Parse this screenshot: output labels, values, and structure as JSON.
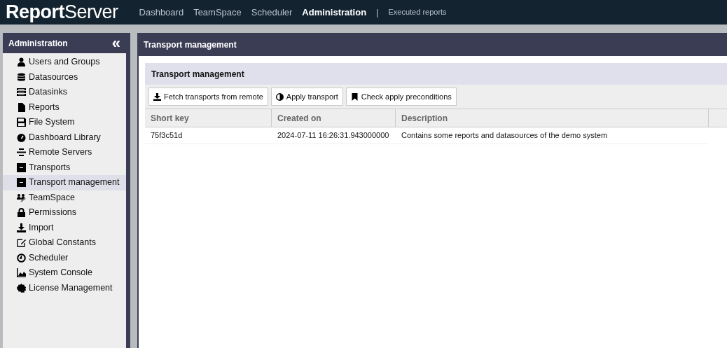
{
  "logo": "**Report**Server",
  "top_nav": [
    {
      "label": "Dashboard",
      "selected": false
    },
    {
      "label": "TeamSpace",
      "selected": false
    },
    {
      "label": "Scheduler",
      "selected": false
    },
    {
      "label": "Administration",
      "selected": true
    }
  ],
  "top_separator": "|",
  "top_link": "Executed reports",
  "sidebar": {
    "title": "Administration",
    "collapse": "«",
    "items": [
      {
        "label": "Users and Groups",
        "selected": false
      },
      {
        "label": "Datasources",
        "selected": false
      },
      {
        "label": "Datasinks",
        "selected": false
      },
      {
        "label": "Reports",
        "selected": false
      },
      {
        "label": "File System",
        "selected": false
      },
      {
        "label": "Dashboard Library",
        "selected": false
      },
      {
        "label": "Remote Servers",
        "selected": false
      },
      {
        "label": "Transports",
        "selected": false
      },
      {
        "label": "Transport management",
        "selected": true
      },
      {
        "label": "TeamSpace",
        "selected": false
      },
      {
        "label": "Permissions",
        "selected": false
      },
      {
        "label": "Import",
        "selected": false
      },
      {
        "label": "Global Constants",
        "selected": false
      },
      {
        "label": "Scheduler",
        "selected": false
      },
      {
        "label": "System Console",
        "selected": false
      },
      {
        "label": "License Management",
        "selected": false
      }
    ]
  },
  "main": {
    "title": "Transport management",
    "panel_title": "Transport management",
    "toolbar": [
      "Fetch transports from remote",
      "Apply transport",
      "Check apply preconditions"
    ],
    "table": {
      "columns": [
        "Short key",
        "Created on",
        "Description"
      ],
      "rows": [
        [
          "75f3c51d",
          "2024-07-11 16:26:31.943000000",
          "Contains some reports and datasources of the demo system"
        ]
      ]
    }
  }
}
